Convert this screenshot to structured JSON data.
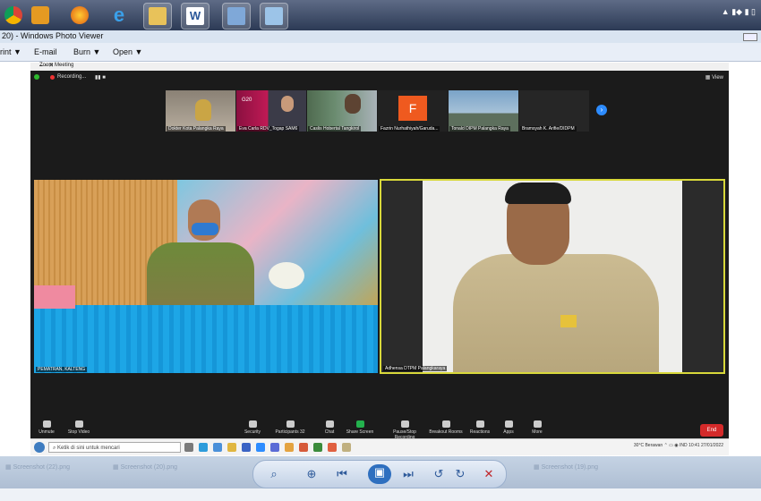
{
  "viewer": {
    "title": "20) - Windows Photo Viewer",
    "menu": [
      {
        "label": "rint",
        "arrow": "▼"
      },
      {
        "label": "E-mail",
        "arrow": ""
      },
      {
        "label": "Burn",
        "arrow": "▼"
      },
      {
        "label": "Open",
        "arrow": "▼"
      }
    ]
  },
  "zoom": {
    "window_title": "Zoom Meeting",
    "recording": "Recording...",
    "view_label": "View",
    "participants": [
      {
        "name": "Dokter Kota Palangka Raya"
      },
      {
        "name": "Eva Carla RDV_Togap SAM6"
      },
      {
        "name": "Caslis Hobertal Tangkirol"
      },
      {
        "name": "Fazrin Nurhathiyah/Garuda..."
      },
      {
        "name": "Tonald DIPM Palangka Raya"
      },
      {
        "name": "Bramsyah K. Arifie/DIDPM"
      }
    ],
    "avatar_letter": "F",
    "main_left_name": "PEMATRAN, KALTENG",
    "main_right_name": "Adhensa DTPM Palangkaraya",
    "toolbar": [
      {
        "label": "Unmute"
      },
      {
        "label": "Stop Video"
      },
      {
        "label": "Security"
      },
      {
        "label": "Participants",
        "count": "32"
      },
      {
        "label": "Chat"
      },
      {
        "label": "Share Screen"
      },
      {
        "label": "Pause/Stop Recording"
      },
      {
        "label": "Breakout Rooms"
      },
      {
        "label": "Reactions"
      },
      {
        "label": "Apps"
      },
      {
        "label": "More"
      }
    ],
    "end_label": "End"
  },
  "inner_taskbar": {
    "search_placeholder": "Ketik di sini untuk mencari",
    "weather": "30°C Berawan",
    "time": "10:41",
    "date": "27/01/2022",
    "lang": "IND"
  },
  "strip": [
    "Screenshot (22).png",
    "Screenshot (20).png",
    "Screenshot (19).png"
  ],
  "colors": {
    "speaker_border": "#d8d83a",
    "end_button": "#d42a2a",
    "taskbar": "#2c3a55"
  }
}
